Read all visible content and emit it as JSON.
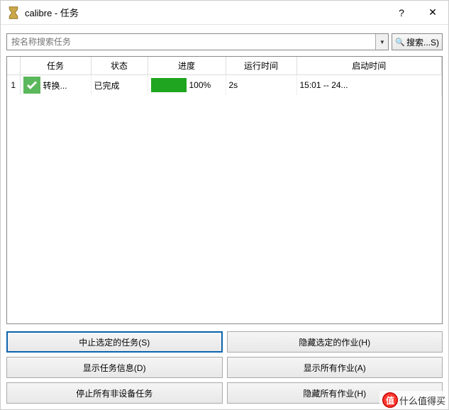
{
  "window": {
    "title": "calibre - 任务"
  },
  "search": {
    "placeholder": "按名称搜索任务",
    "button_label": "搜索...S)"
  },
  "table": {
    "headers": {
      "row": "",
      "task": "任务",
      "status": "状态",
      "progress": "进度",
      "runtime": "运行时间",
      "started": "启动时间"
    },
    "rows": [
      {
        "num": "1",
        "task": "转换...",
        "status": "已完成",
        "progress_pct": 100,
        "progress_label": "100%",
        "runtime": "2s",
        "started": "15:01 -- 24..."
      }
    ]
  },
  "buttons": {
    "stop_selected": "中止选定的任务(S)",
    "hide_selected": "隐藏选定的作业(H)",
    "task_info": "显示任务信息(D)",
    "show_all": "显示所有作业(A)",
    "stop_non_device": "停止所有非设备任务",
    "hide_all": "隐藏所有作业(H)"
  },
  "watermark": {
    "logo_char": "值",
    "text": "什么值得买"
  }
}
